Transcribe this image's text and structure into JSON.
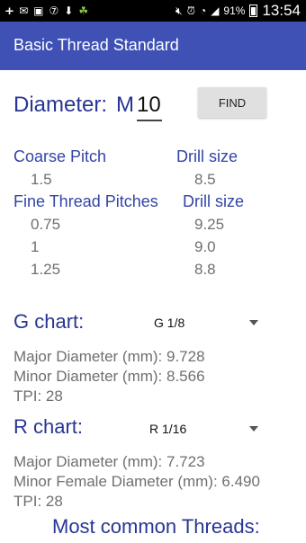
{
  "status_bar": {
    "battery": "91%",
    "time": "13:54",
    "left_icons": [
      "plus-icon",
      "mail-icon",
      "zalo-icon",
      "seven-icon",
      "download-icon",
      "android-icon"
    ],
    "right_icons": [
      "mute-icon",
      "alarm-icon",
      "wifi-icon",
      "signal-icon"
    ]
  },
  "app_bar": {
    "title": "Basic Thread Standard"
  },
  "diameter": {
    "label": "Diameter:",
    "prefix": "M",
    "value": "10",
    "find_label": "FIND"
  },
  "coarse": {
    "pitch_header": "Coarse Pitch",
    "drill_header": "Drill size",
    "pitch": "1.5",
    "drill": "8.5"
  },
  "fine": {
    "pitch_header": "Fine Thread Pitches",
    "drill_header": "Drill size",
    "rows": [
      {
        "pitch": "0.75",
        "drill": "9.25"
      },
      {
        "pitch": "1",
        "drill": "9.0"
      },
      {
        "pitch": "1.25",
        "drill": "8.8"
      }
    ]
  },
  "g_chart": {
    "label": "G chart:",
    "selected": "G 1/8",
    "major": "Major Diameter (mm): 9.728",
    "minor": "Minor Diameter (mm): 8.566",
    "tpi": "TPI: 28"
  },
  "r_chart": {
    "label": "R chart:",
    "selected": "R 1/16",
    "major": "Major Diameter (mm): 7.723",
    "minor": "Minor Female Diameter (mm): 6.490",
    "tpi": "TPI: 28"
  },
  "common_title": "Most common Threads:",
  "colors": {
    "app_bar": "#3f51b5",
    "label_blue": "#283593",
    "value_grey": "#6f6f6f"
  }
}
